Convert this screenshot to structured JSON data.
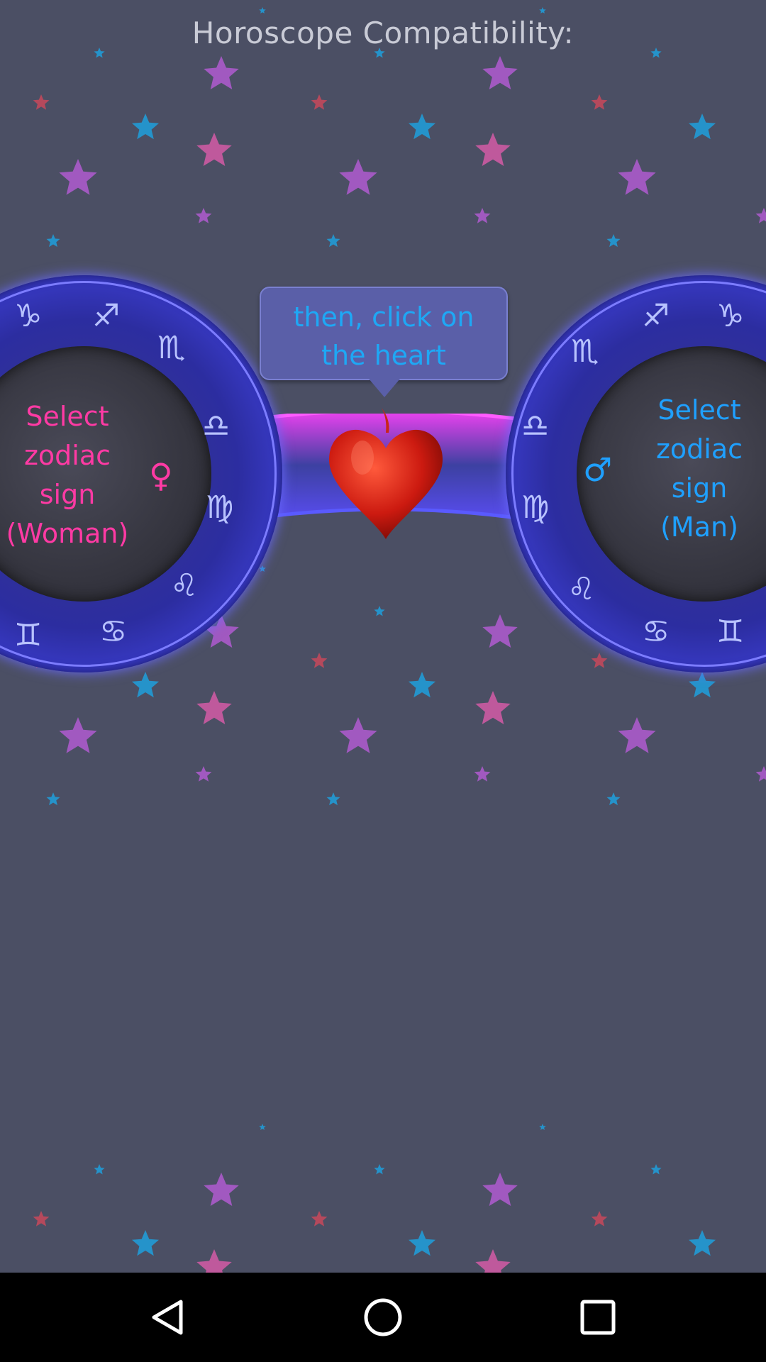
{
  "screen": {
    "title": "Horoscope Compatibility:"
  },
  "woman_wheel": {
    "label": "Select\nzodiac\nsign\n(Woman)",
    "symbol": "♀",
    "accent": "#ff3aa4"
  },
  "man_wheel": {
    "label": "Select\nzodiac\nsign\n(Man)",
    "symbol": "♂",
    "accent": "#1fa0ff"
  },
  "hint": {
    "text": "then, click on\nthe heart"
  },
  "heart": {
    "icon": "heart-icon",
    "color": "#cc1a10"
  },
  "colors": {
    "background": "#4b4f64",
    "star_pink": "#d45aa6",
    "star_violet": "#b05ad0",
    "star_blue": "#1f9fdc",
    "star_red": "#c8485a"
  },
  "navbar": {
    "back_icon": "back-triangle-icon",
    "home_icon": "home-circle-icon",
    "recent_icon": "recent-apps-square-icon"
  }
}
